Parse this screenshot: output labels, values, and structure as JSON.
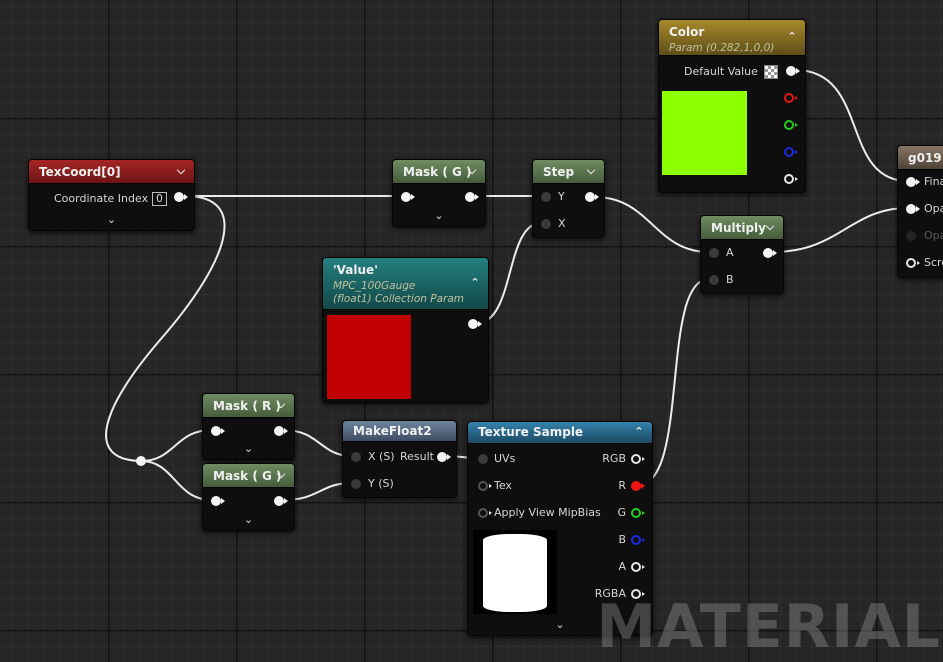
{
  "nodes": {
    "texcoord": {
      "title": "TexCoord[0]",
      "input_label": "Coordinate Index",
      "index_value": "0"
    },
    "mask_g_top": {
      "title": "Mask ( G )"
    },
    "step": {
      "title": "Step",
      "pin_y": "Y",
      "pin_x": "X"
    },
    "value_param": {
      "title": "'Value'",
      "subtitle_line1": "MPC_100Gauge",
      "subtitle_line2": "(float1) Collection Param",
      "preview_color": "#c00000"
    },
    "color_param": {
      "title": "Color",
      "subtitle": "Param (0.282,1,0,0)",
      "default_label": "Default Value",
      "preview_color": "#8cff00"
    },
    "multiply": {
      "title": "Multiply",
      "pin_a": "A",
      "pin_b": "B"
    },
    "mask_r": {
      "title": "Mask ( R )"
    },
    "mask_g_bottom": {
      "title": "Mask ( G )"
    },
    "makefloat2": {
      "title": "MakeFloat2",
      "pin_x": "X (S)",
      "pin_y": "Y (S)",
      "pin_result": "Result"
    },
    "texture_sample": {
      "title": "Texture Sample",
      "inputs": [
        "UVs",
        "Tex",
        "Apply View MipBias"
      ],
      "outputs": [
        "RGB",
        "R",
        "G",
        "B",
        "A",
        "RGBA"
      ]
    },
    "material_result": {
      "title": "g019",
      "pins": [
        "Fina",
        "Opa",
        "Opa",
        "Scre"
      ]
    }
  },
  "colors": {
    "texcoord_header": "#8a1c1c",
    "mask_header": "#5e7a52",
    "value_header": "#1d6b6b",
    "color_header": "#8c7420",
    "texture_header": "#2b6a8c",
    "makefloat_header": "#5a6e88",
    "result_header": "#6b5d4c"
  },
  "watermark": "MATERIAL"
}
